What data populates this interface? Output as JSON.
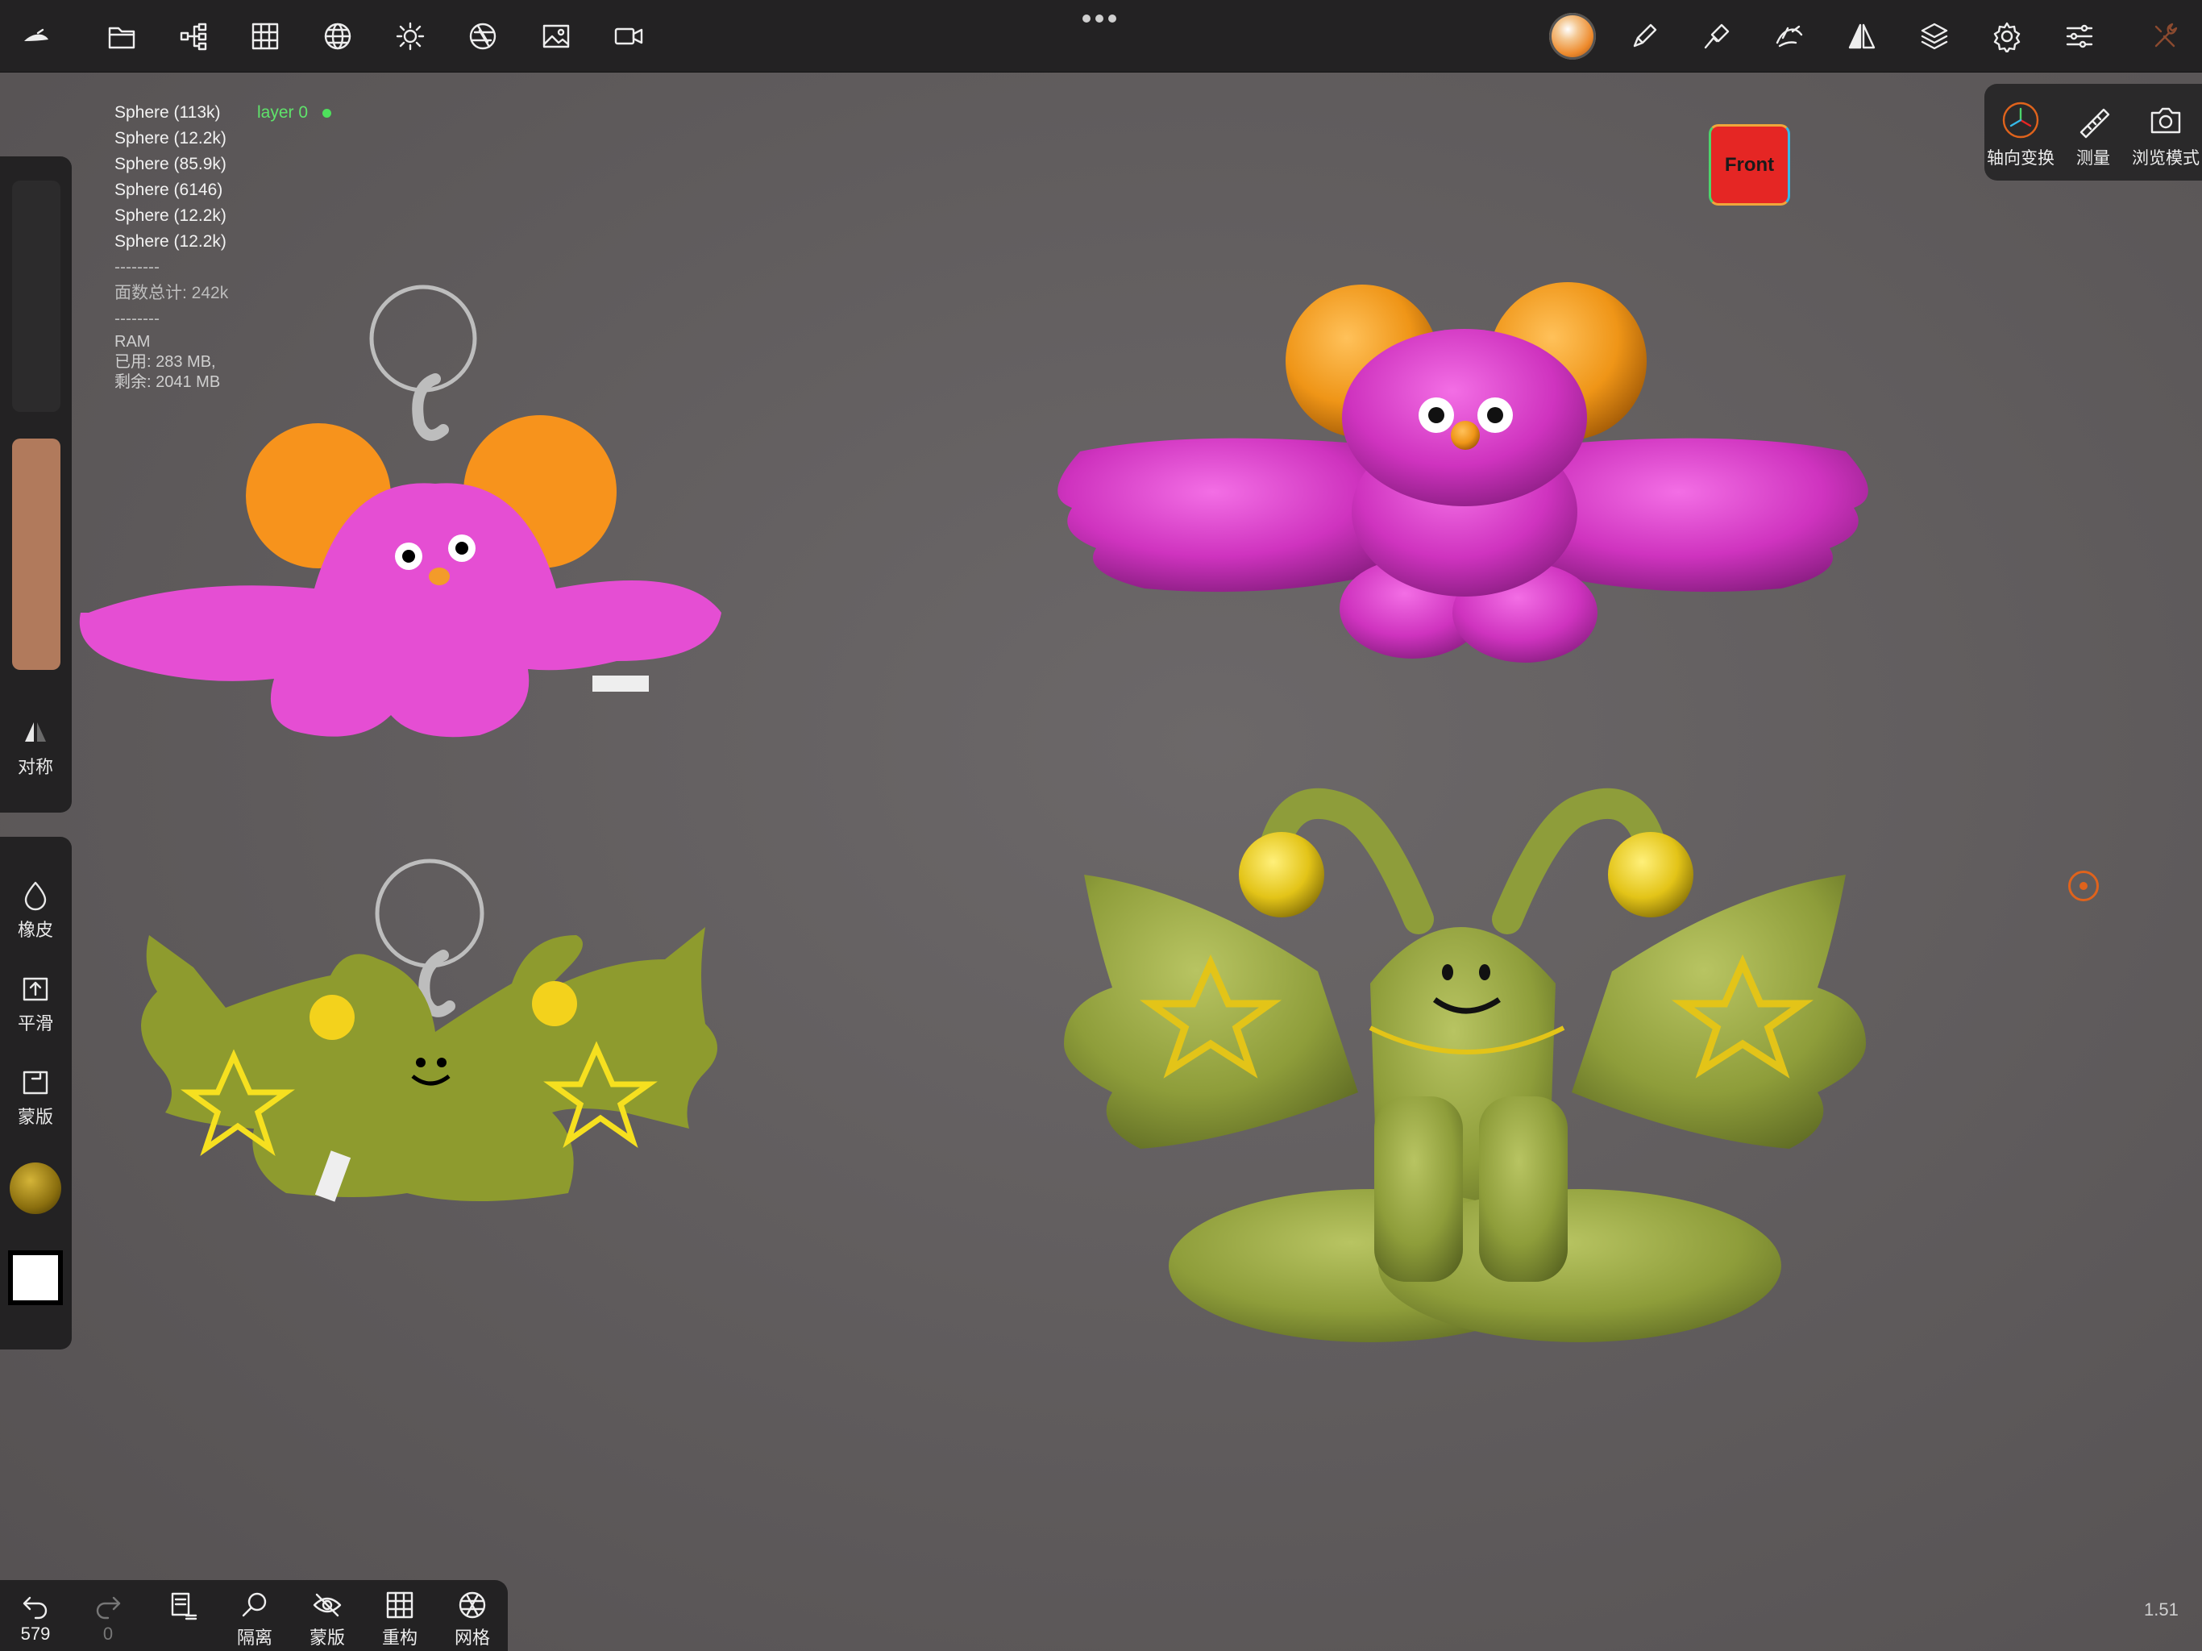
{
  "toolbar": {
    "left_icons": [
      "home-icon",
      "folder-icon",
      "scene-tree-icon",
      "grid-icon",
      "sphere-wire-icon",
      "sun-icon",
      "aperture-icon",
      "image-icon",
      "video-icon"
    ],
    "right_icons": [
      "material-ball-icon",
      "brush-icon",
      "paint-icon",
      "pose-icon",
      "symmetry-icon",
      "layers-icon",
      "gear-icon",
      "sliders-icon",
      "tools-icon"
    ]
  },
  "stats": {
    "meshes": [
      "Sphere (113k)",
      "Sphere (12.2k)",
      "Sphere (85.9k)",
      "Sphere (6146)",
      "Sphere (12.2k)",
      "Sphere (12.2k)"
    ],
    "layer": "layer 0",
    "sep1": "--------",
    "face_total": "面数总计:  242k",
    "sep2": "--------",
    "ram_label": "RAM",
    "ram_used": "已用:  283 MB,",
    "ram_free": "剩余:  2041 MB"
  },
  "left_panel": {
    "symmetry_label": "对称",
    "eraser_label": "橡皮",
    "smooth_label": "平滑",
    "mask_label": "蒙版",
    "brush_color": "#b17a5c"
  },
  "view_cube": {
    "label": "Front"
  },
  "right_panel": {
    "gizmo_label": "轴向变换",
    "measure_label": "测量",
    "camera_label": "浏览模式"
  },
  "bottom_bar": {
    "undo_count": "579",
    "redo_count": "0",
    "isolate_label": "隔离",
    "hide_label": "蒙版",
    "remesh_label": "重构",
    "wire_label": "网格"
  },
  "zoom": "1.51",
  "colors": {
    "accent": "#e0631c",
    "layer_green": "#5fe36b",
    "magenta": "#d43fc4",
    "olive": "#8da03a"
  }
}
